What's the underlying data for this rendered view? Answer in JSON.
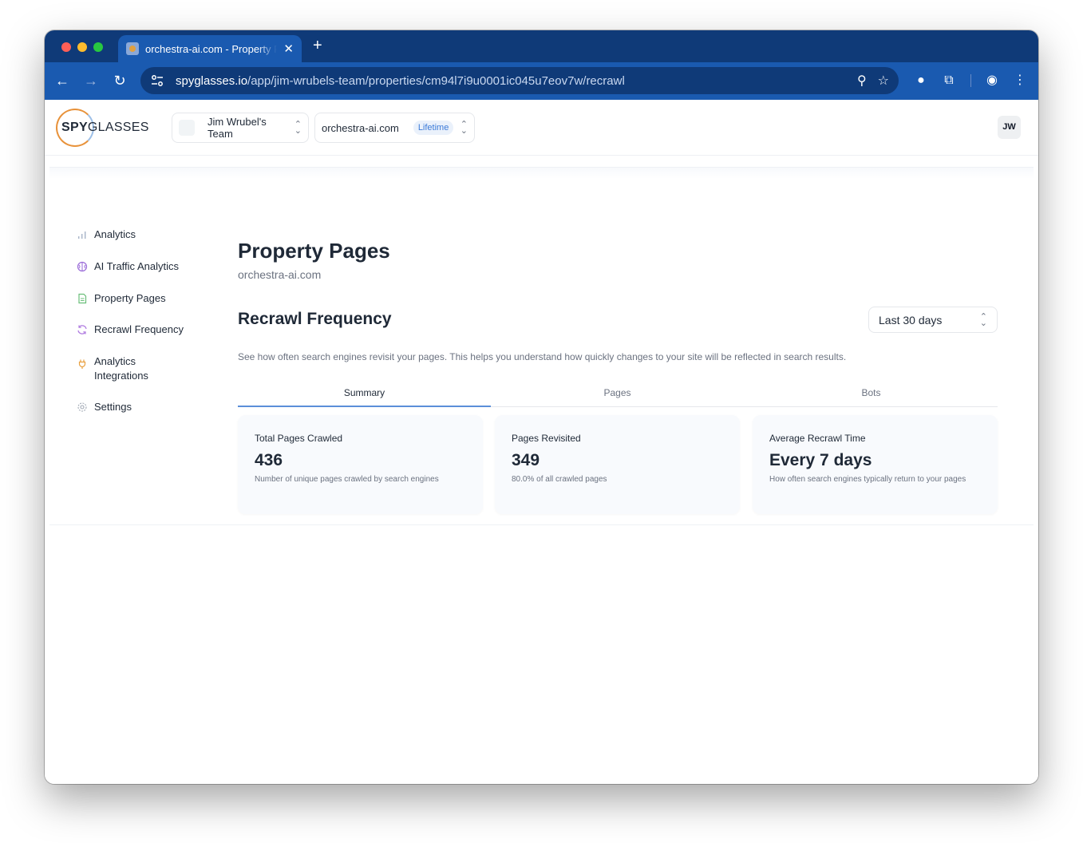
{
  "browser": {
    "tab_title": "orchestra-ai.com - Property Pages",
    "url_host": "spyglasses.io",
    "url_path": "/app/jim-wrubels-team/properties/cm94l7i9u0001ic045u7eov7w/recrawl"
  },
  "header": {
    "logo_bold": "SPY",
    "logo_light": "GLASSES",
    "team_name": "Jim Wrubel's Team",
    "property_name": "orchestra-ai.com",
    "property_badge": "Lifetime",
    "user_initials": "JW"
  },
  "sidebar": {
    "items": [
      {
        "label": "Analytics",
        "icon": "bar-chart-icon"
      },
      {
        "label": "AI Traffic Analytics",
        "icon": "brain-icon"
      },
      {
        "label": "Property Pages",
        "icon": "document-icon"
      },
      {
        "label": "Recrawl Frequency",
        "icon": "refresh-icon"
      },
      {
        "label": "Analytics Integrations",
        "icon": "plug-icon"
      },
      {
        "label": "Settings",
        "icon": "gear-icon"
      }
    ]
  },
  "main": {
    "title": "Property Pages",
    "subtitle": "orchestra-ai.com",
    "section_title": "Recrawl Frequency",
    "range": "Last 30 days",
    "description": "See how often search engines revisit your pages. This helps you understand how quickly changes to your site will be reflected in search results.",
    "tabs": [
      {
        "label": "Summary",
        "active": true
      },
      {
        "label": "Pages",
        "active": false
      },
      {
        "label": "Bots",
        "active": false
      }
    ],
    "cards": [
      {
        "label": "Total Pages Crawled",
        "value": "436",
        "sub": "Number of unique pages crawled by search engines"
      },
      {
        "label": "Pages Revisited",
        "value": "349",
        "sub": "80.0% of all crawled pages"
      },
      {
        "label": "Average Recrawl Time",
        "value": "Every 7 days",
        "sub": "How often search engines typically return to your pages"
      }
    ]
  },
  "colors": {
    "tab_strip": "#0f3a78",
    "toolbar": "#1a5ab0",
    "accent": "#5b8fd9",
    "logo_orange": "#e8923a"
  }
}
